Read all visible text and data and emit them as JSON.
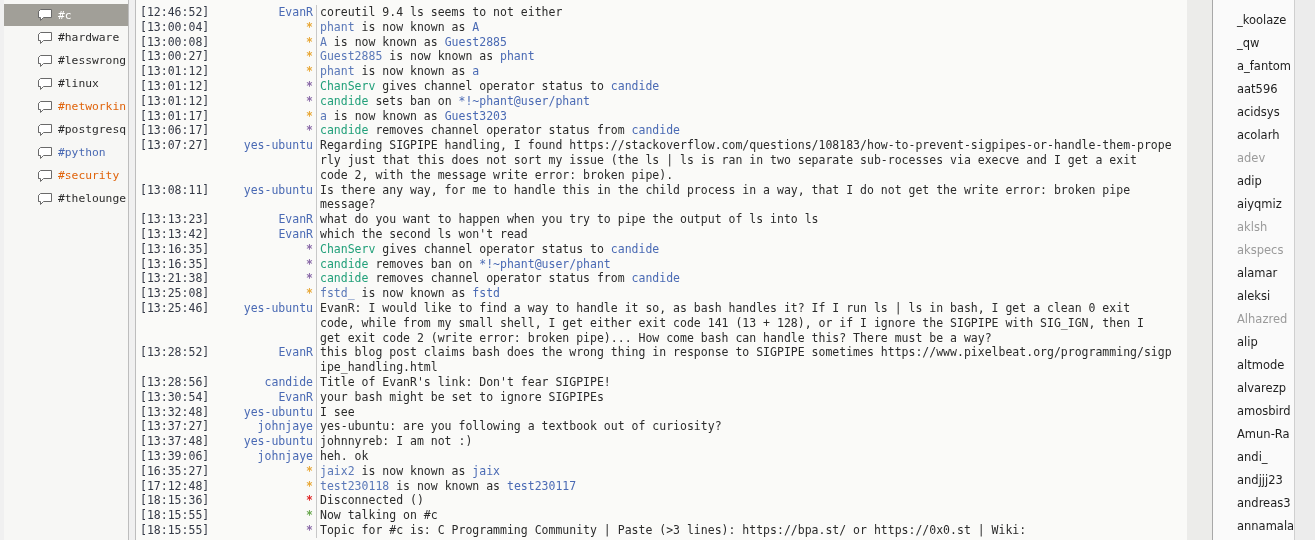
{
  "channels": [
    {
      "name": "#c",
      "selected": true,
      "color": "#ffffff"
    },
    {
      "name": "#hardware",
      "selected": false,
      "color": "#2b2b2b"
    },
    {
      "name": "#lesswrong",
      "selected": false,
      "color": "#2b2b2b"
    },
    {
      "name": "#linux",
      "selected": false,
      "color": "#2b2b2b"
    },
    {
      "name": "#networkin",
      "selected": false,
      "color": "#e0640c"
    },
    {
      "name": "#postgresq",
      "selected": false,
      "color": "#2b2b2b"
    },
    {
      "name": "#python",
      "selected": false,
      "color": "#4a6ab4"
    },
    {
      "name": "#security",
      "selected": false,
      "color": "#e0640c"
    },
    {
      "name": "#thelounge",
      "selected": false,
      "color": "#2b2b2b"
    }
  ],
  "messages": [
    {
      "time": "[12:46:52]",
      "nick": "EvanR",
      "color": "#4a6ab4",
      "kind": "text",
      "lines": [
        "coreutil 9.4 ls seems to not either"
      ]
    },
    {
      "time": "[13:00:04]",
      "nick": "*",
      "color": "#e8a838",
      "kind": "event",
      "segments": [
        {
          "text": "phant",
          "color": "#5a78b8"
        },
        {
          "text": " is now known as ",
          "color": "#2b2b2b"
        },
        {
          "text": "A",
          "color": "#4a6ab4"
        }
      ]
    },
    {
      "time": "[13:00:08]",
      "nick": "*",
      "color": "#e8a838",
      "kind": "event",
      "segments": [
        {
          "text": "A",
          "color": "#5a78b8"
        },
        {
          "text": " is now known as ",
          "color": "#2b2b2b"
        },
        {
          "text": "Guest2885",
          "color": "#4a6ab4"
        }
      ]
    },
    {
      "time": "[13:00:27]",
      "nick": "*",
      "color": "#e8a838",
      "kind": "event",
      "segments": [
        {
          "text": "Guest2885",
          "color": "#5a78b8"
        },
        {
          "text": " is now known as ",
          "color": "#2b2b2b"
        },
        {
          "text": "phant",
          "color": "#4a6ab4"
        }
      ]
    },
    {
      "time": "[13:01:12]",
      "nick": "*",
      "color": "#e8a838",
      "kind": "event",
      "segments": [
        {
          "text": "phant",
          "color": "#5a78b8"
        },
        {
          "text": " is now known as ",
          "color": "#2b2b2b"
        },
        {
          "text": "a",
          "color": "#4a6ab4"
        }
      ]
    },
    {
      "time": "[13:01:12]",
      "nick": "*",
      "color": "#8a6aa8",
      "kind": "event",
      "segments": [
        {
          "text": "ChanServ",
          "color": "#22a07a"
        },
        {
          "text": " gives channel operator status to ",
          "color": "#2b2b2b"
        },
        {
          "text": "candide",
          "color": "#4a6ab4"
        }
      ]
    },
    {
      "time": "[13:01:12]",
      "nick": "*",
      "color": "#8a6aa8",
      "kind": "event",
      "segments": [
        {
          "text": "candide",
          "color": "#22a07a"
        },
        {
          "text": " sets ban on ",
          "color": "#2b2b2b"
        },
        {
          "text": "*!~phant@user/phant",
          "color": "#4a6ab4"
        }
      ]
    },
    {
      "time": "[13:01:17]",
      "nick": "*",
      "color": "#e8a838",
      "kind": "event",
      "segments": [
        {
          "text": "a",
          "color": "#5a78b8"
        },
        {
          "text": " is now known as ",
          "color": "#2b2b2b"
        },
        {
          "text": "Guest3203",
          "color": "#4a6ab4"
        }
      ]
    },
    {
      "time": "[13:06:17]",
      "nick": "*",
      "color": "#8a6aa8",
      "kind": "event",
      "segments": [
        {
          "text": "candide",
          "color": "#22a07a"
        },
        {
          "text": " removes channel operator status from ",
          "color": "#2b2b2b"
        },
        {
          "text": "candide",
          "color": "#4a6ab4"
        }
      ]
    },
    {
      "time": "[13:07:27]",
      "nick": "yes-ubuntu",
      "color": "#4a6ab4",
      "kind": "text",
      "lines": [
        "Regarding SIGPIPE handling, I found https://stackoverflow.com/questions/108183/how-to-prevent-sigpipes-or-handle-them-prope",
        "rly just that this does not sort my issue (the ls | ls is ran in two separate sub-rocesses via execve and I get a exit",
        "code 2, with the message write error: broken pipe)."
      ]
    },
    {
      "time": "[13:08:11]",
      "nick": "yes-ubuntu",
      "color": "#4a6ab4",
      "kind": "text",
      "lines": [
        "Is there any way, for me to handle this in the child process in a way, that I do not get the write error: broken pipe",
        "message?"
      ]
    },
    {
      "time": "[13:13:23]",
      "nick": "EvanR",
      "color": "#4a6ab4",
      "kind": "text",
      "lines": [
        "what do you want to happen when you try to pipe the output of ls into ls"
      ]
    },
    {
      "time": "[13:13:42]",
      "nick": "EvanR",
      "color": "#4a6ab4",
      "kind": "text",
      "lines": [
        "which the second ls won't read"
      ]
    },
    {
      "time": "[13:16:35]",
      "nick": "*",
      "color": "#8a6aa8",
      "kind": "event",
      "segments": [
        {
          "text": "ChanServ",
          "color": "#22a07a"
        },
        {
          "text": " gives channel operator status to ",
          "color": "#2b2b2b"
        },
        {
          "text": "candide",
          "color": "#4a6ab4"
        }
      ]
    },
    {
      "time": "[13:16:35]",
      "nick": "*",
      "color": "#8a6aa8",
      "kind": "event",
      "segments": [
        {
          "text": "candide",
          "color": "#22a07a"
        },
        {
          "text": " removes ban on ",
          "color": "#2b2b2b"
        },
        {
          "text": "*!~phant@user/phant",
          "color": "#4a6ab4"
        }
      ]
    },
    {
      "time": "[13:21:38]",
      "nick": "*",
      "color": "#8a6aa8",
      "kind": "event",
      "segments": [
        {
          "text": "candide",
          "color": "#22a07a"
        },
        {
          "text": " removes channel operator status from ",
          "color": "#2b2b2b"
        },
        {
          "text": "candide",
          "color": "#4a6ab4"
        }
      ]
    },
    {
      "time": "[13:25:08]",
      "nick": "*",
      "color": "#e8a838",
      "kind": "event",
      "segments": [
        {
          "text": "fstd_",
          "color": "#5a78b8"
        },
        {
          "text": " is now known as ",
          "color": "#2b2b2b"
        },
        {
          "text": "fstd",
          "color": "#4a6ab4"
        }
      ]
    },
    {
      "time": "[13:25:46]",
      "nick": "yes-ubuntu",
      "color": "#4a6ab4",
      "kind": "text",
      "lines": [
        "EvanR: I would like to find a way to handle it so, as bash handles it? If I run ls | ls in bash, I get a clean 0 exit",
        "code, while from my small shell, I get either exit code 141 (13 + 128), or if I ignore the SIGPIPE with SIG_IGN, then I",
        "get exit code 2 (write error: broken pipe)... How come bash can handle this? There must be a way?"
      ]
    },
    {
      "time": "[13:28:52]",
      "nick": "EvanR",
      "color": "#4a6ab4",
      "kind": "text",
      "lines": [
        "this blog post claims bash does the wrong thing in response to SIGPIPE sometimes https://www.pixelbeat.org/programming/sigp",
        "ipe_handling.html"
      ]
    },
    {
      "time": "[13:28:56]",
      "nick": "candide",
      "color": "#4a6ab4",
      "kind": "text",
      "lines": [
        "Title of EvanR's link: Don't fear SIGPIPE!"
      ]
    },
    {
      "time": "[13:30:54]",
      "nick": "EvanR",
      "color": "#4a6ab4",
      "kind": "text",
      "lines": [
        "your bash might be set to ignore SIGPIPEs"
      ]
    },
    {
      "time": "[13:32:48]",
      "nick": "yes-ubuntu",
      "color": "#4a6ab4",
      "kind": "text",
      "lines": [
        "I see"
      ]
    },
    {
      "time": "[13:37:27]",
      "nick": "johnjaye",
      "color": "#4a6ab4",
      "kind": "text",
      "lines": [
        "yes-ubuntu: are you following a textbook out of curiosity?"
      ]
    },
    {
      "time": "[13:37:48]",
      "nick": "yes-ubuntu",
      "color": "#4a6ab4",
      "kind": "text",
      "lines": [
        "johnnyreb: I am not :)"
      ]
    },
    {
      "time": "[13:39:06]",
      "nick": "johnjaye",
      "color": "#4a6ab4",
      "kind": "text",
      "lines": [
        "heh. ok"
      ]
    },
    {
      "time": "[16:35:27]",
      "nick": "*",
      "color": "#e8a838",
      "kind": "event",
      "segments": [
        {
          "text": "jaix2",
          "color": "#5a78b8"
        },
        {
          "text": " is now known as ",
          "color": "#2b2b2b"
        },
        {
          "text": "jaix",
          "color": "#4a6ab4"
        }
      ]
    },
    {
      "time": "[17:12:48]",
      "nick": "*",
      "color": "#e8a838",
      "kind": "event",
      "segments": [
        {
          "text": "test230118",
          "color": "#5a78b8"
        },
        {
          "text": " is now known as ",
          "color": "#2b2b2b"
        },
        {
          "text": "test230117",
          "color": "#4a6ab4"
        }
      ]
    },
    {
      "time": "[18:15:36]",
      "nick": "*",
      "color": "#e02828",
      "kind": "event",
      "segments": [
        {
          "text": "Disconnected ()",
          "color": "#2b2b2b"
        }
      ]
    },
    {
      "time": "[18:15:55]",
      "nick": "*",
      "color": "#6aa84f",
      "kind": "event",
      "segments": [
        {
          "text": "Now talking on #c",
          "color": "#2b2b2b"
        }
      ]
    },
    {
      "time": "[18:15:55]",
      "nick": "*",
      "color": "#8a6aa8",
      "kind": "event",
      "segments": [
        {
          "text": "Topic for #c is: C Programming Community | Paste (>3 lines): https://bpa.st/ or https://0x0.st | Wiki:",
          "color": "#2b2b2b"
        }
      ]
    }
  ],
  "users": [
    {
      "name": "_koolaze",
      "away": false
    },
    {
      "name": "_qw",
      "away": false
    },
    {
      "name": "a_fantom",
      "away": false
    },
    {
      "name": "aat596",
      "away": false
    },
    {
      "name": "acidsys",
      "away": false
    },
    {
      "name": "acolarh",
      "away": false
    },
    {
      "name": "adev",
      "away": true
    },
    {
      "name": "adip",
      "away": false
    },
    {
      "name": "aiyqmiz",
      "away": false
    },
    {
      "name": "aklsh",
      "away": true
    },
    {
      "name": "akspecs",
      "away": true
    },
    {
      "name": "alamar",
      "away": false
    },
    {
      "name": "aleksi",
      "away": false
    },
    {
      "name": "Alhazred",
      "away": true
    },
    {
      "name": "alip",
      "away": false
    },
    {
      "name": "altmode",
      "away": false
    },
    {
      "name": "alvarezp",
      "away": false
    },
    {
      "name": "amosbird",
      "away": false
    },
    {
      "name": "Amun-Ra",
      "away": false
    },
    {
      "name": "andi_",
      "away": false
    },
    {
      "name": "andjjj23",
      "away": false
    },
    {
      "name": "andreas3",
      "away": false
    },
    {
      "name": "annamala",
      "away": false
    }
  ]
}
